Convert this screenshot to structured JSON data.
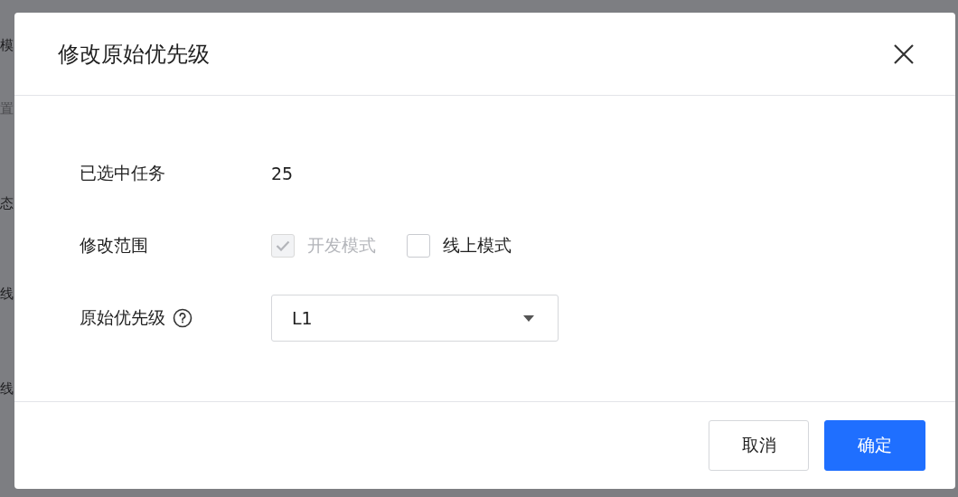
{
  "background": {
    "column_texts": [
      "模",
      "置",
      "态",
      "线",
      "线"
    ]
  },
  "dialog": {
    "title": "修改原始优先级",
    "fields": [
      {
        "kind": "text",
        "label": "已选中任务",
        "value": "25"
      },
      {
        "kind": "checkboxes",
        "label": "修改范围",
        "options": [
          {
            "label": "开发模式",
            "checked": true,
            "disabled": true
          },
          {
            "label": "线上模式",
            "checked": false,
            "disabled": false
          }
        ]
      },
      {
        "kind": "select",
        "label": "原始优先级",
        "help": true,
        "value": "L1"
      }
    ],
    "buttons": [
      {
        "label": "取消",
        "kind": "default"
      },
      {
        "label": "确定",
        "kind": "primary"
      }
    ]
  }
}
